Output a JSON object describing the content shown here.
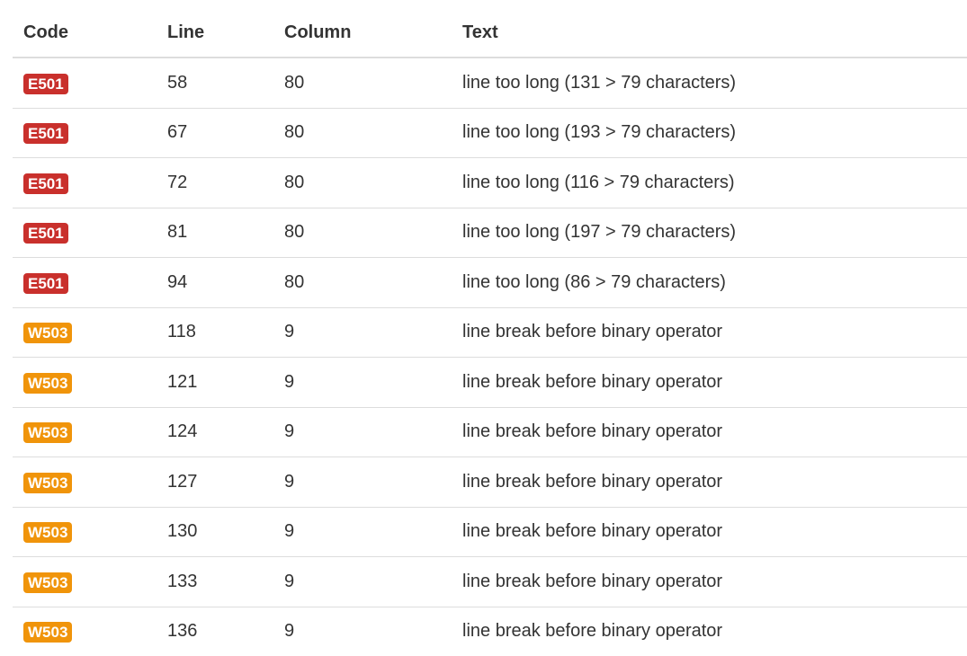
{
  "table": {
    "headers": {
      "code": "Code",
      "line": "Line",
      "column": "Column",
      "text": "Text"
    },
    "rows": [
      {
        "code": "E501",
        "severity": "error",
        "line": "58",
        "column": "80",
        "text": "line too long (131 > 79 characters)"
      },
      {
        "code": "E501",
        "severity": "error",
        "line": "67",
        "column": "80",
        "text": "line too long (193 > 79 characters)"
      },
      {
        "code": "E501",
        "severity": "error",
        "line": "72",
        "column": "80",
        "text": "line too long (116 > 79 characters)"
      },
      {
        "code": "E501",
        "severity": "error",
        "line": "81",
        "column": "80",
        "text": "line too long (197 > 79 characters)"
      },
      {
        "code": "E501",
        "severity": "error",
        "line": "94",
        "column": "80",
        "text": "line too long (86 > 79 characters)"
      },
      {
        "code": "W503",
        "severity": "warning",
        "line": "118",
        "column": "9",
        "text": "line break before binary operator"
      },
      {
        "code": "W503",
        "severity": "warning",
        "line": "121",
        "column": "9",
        "text": "line break before binary operator"
      },
      {
        "code": "W503",
        "severity": "warning",
        "line": "124",
        "column": "9",
        "text": "line break before binary operator"
      },
      {
        "code": "W503",
        "severity": "warning",
        "line": "127",
        "column": "9",
        "text": "line break before binary operator"
      },
      {
        "code": "W503",
        "severity": "warning",
        "line": "130",
        "column": "9",
        "text": "line break before binary operator"
      },
      {
        "code": "W503",
        "severity": "warning",
        "line": "133",
        "column": "9",
        "text": "line break before binary operator"
      },
      {
        "code": "W503",
        "severity": "warning",
        "line": "136",
        "column": "9",
        "text": "line break before binary operator"
      }
    ]
  },
  "colors": {
    "error_badge": "#c9302c",
    "warning_badge": "#f0940a",
    "text": "#333333",
    "border": "#dddddd"
  }
}
